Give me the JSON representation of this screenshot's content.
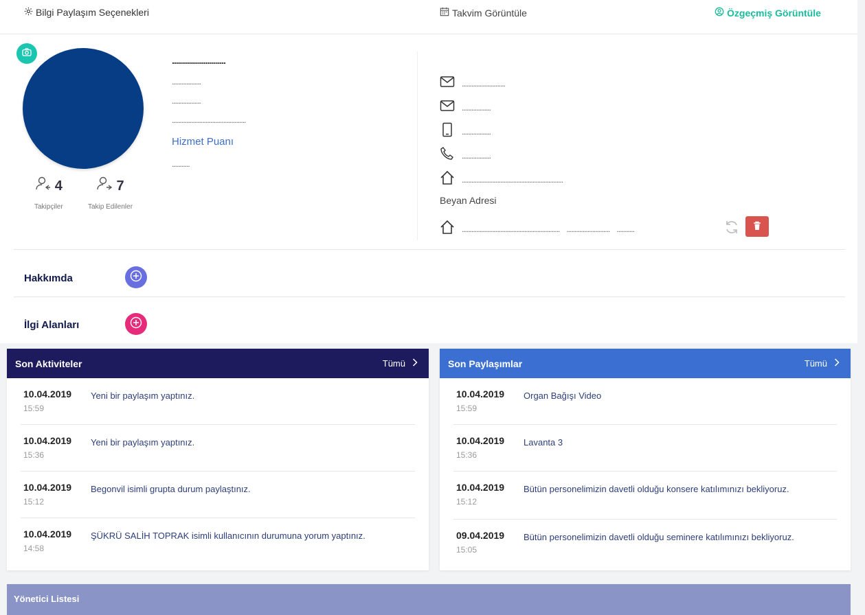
{
  "topbar": {
    "share_options": "Bilgi Paylaşım Seçenekleri",
    "calendar": "Takvim Görüntüle",
    "cv": "Özgeçmiş Görüntüle"
  },
  "profile": {
    "name_masked": "...........................",
    "line2": "..................",
    "line3": "..................",
    "line4": "..............................................",
    "service_points_label": "Hizmet Puanı",
    "service_points_value": "...........",
    "followers_count": "4",
    "followers_label": "Takipçiler",
    "following_count": "7",
    "following_label": "Takip Edilenler"
  },
  "contact": {
    "email1": "...........................",
    "email2": "..................",
    "mobile": "..................",
    "phone": "..................",
    "address": "...............................................................",
    "declared_address_label": "Beyan Adresi",
    "declared_address_1": ".............................................................",
    "declared_address_2": "...........................",
    "declared_address_3": "..........."
  },
  "sections": {
    "about": "Hakkımda",
    "interests": "İlgi Alanları"
  },
  "activities": {
    "title": "Son Aktiviteler",
    "all": "Tümü",
    "items": [
      {
        "date": "10.04.2019",
        "time": "15:59",
        "text": "Yeni bir paylaşım yaptınız."
      },
      {
        "date": "10.04.2019",
        "time": "15:36",
        "text": "Yeni bir paylaşım yaptınız."
      },
      {
        "date": "10.04.2019",
        "time": "15:12",
        "text": "Begonvil isimli grupta durum paylaştınız."
      },
      {
        "date": "10.04.2019",
        "time": "14:58",
        "text": "ŞÜKRÜ SALİH TOPRAK isimli kullanıcının durumuna yorum yaptınız."
      }
    ]
  },
  "shares": {
    "title": "Son Paylaşımlar",
    "all": "Tümü",
    "items": [
      {
        "date": "10.04.2019",
        "time": "15:59",
        "text": "Organ Bağışı Video"
      },
      {
        "date": "10.04.2019",
        "time": "15:36",
        "text": "Lavanta 3"
      },
      {
        "date": "10.04.2019",
        "time": "15:12",
        "text": "Bütün personelimizin davetli olduğu konsere katılımınızı bekliyoruz."
      },
      {
        "date": "09.04.2019",
        "time": "15:05",
        "text": "Bütün personelimizin davetli olduğu seminere katılımınızı bekliyoruz."
      }
    ]
  },
  "manager_list": "Yönetici Listesi",
  "colors": {
    "accent_teal": "#1abc9c",
    "avatar_blue": "#073d84",
    "activities_header": "#1d1a5e",
    "shares_header": "#3b6fd1",
    "about_plus": "#6a6fe0",
    "interests_plus": "#e52b7a",
    "delete_red": "#d9534f",
    "manager_header": "#8b94c6"
  }
}
